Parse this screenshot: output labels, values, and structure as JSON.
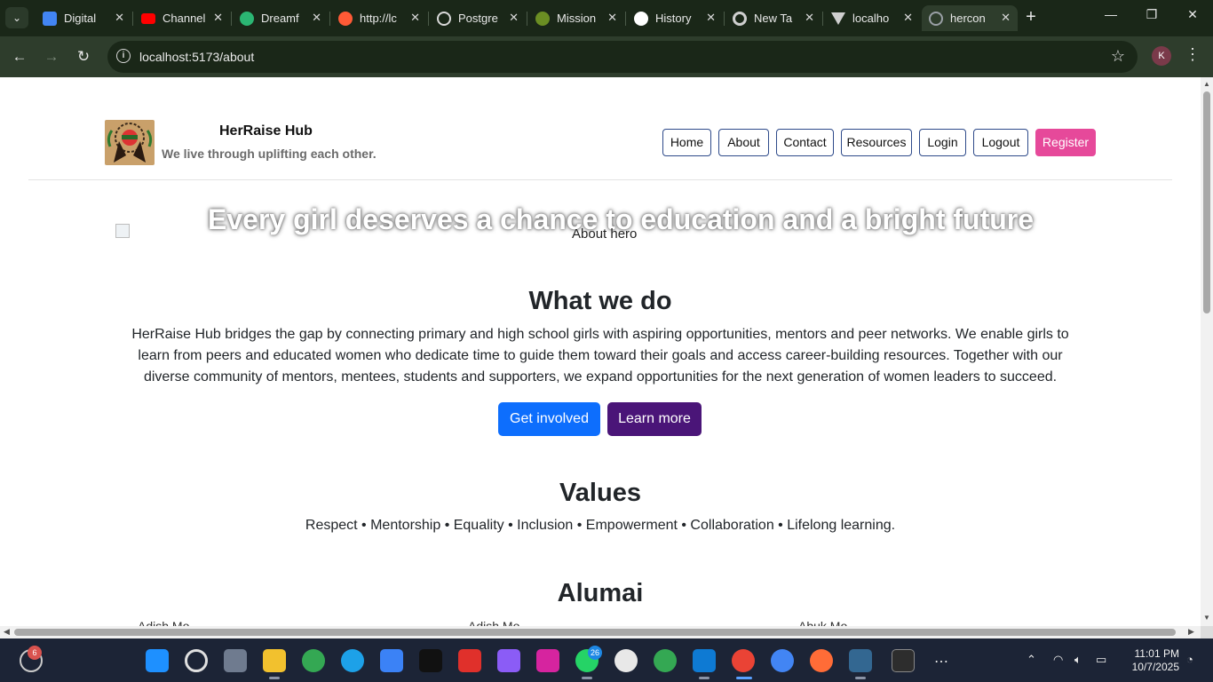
{
  "browser": {
    "tabs": [
      {
        "label": "Digital",
        "color": "#4285f4"
      },
      {
        "label": "Channel",
        "color": "#ff0000"
      },
      {
        "label": "Dreamf",
        "color": "#2bb673"
      },
      {
        "label": "http://lc",
        "color": "#ff5a36"
      },
      {
        "label": "Postgre",
        "color": "#d9d9d9"
      },
      {
        "label": "Mission",
        "color": "#6b8e23"
      },
      {
        "label": "History",
        "color": "#ffffff"
      },
      {
        "label": "New Ta",
        "color": "#cfcfcf"
      },
      {
        "label": "localho",
        "color": "#cfcfcf"
      },
      {
        "label": "hercon",
        "color": "#9aa0a6"
      }
    ],
    "url": "localhost:5173/about",
    "profile_initial": "K"
  },
  "site": {
    "brand_title": "HerRaise Hub",
    "brand_tagline": "We live through uplifting each other.",
    "nav": [
      "Home",
      "About",
      "Contact",
      "Resources",
      "Login",
      "Logout",
      "Register"
    ],
    "hero_text": "Every girl deserves a chance to education and a bright future",
    "hero_alt": "About hero",
    "what_title": "What we do",
    "what_text": "HerRaise Hub bridges the gap by connecting primary and high school girls with aspiring opportunities, mentors and peer networks. We enable girls to learn from peers and educated women who dedicate time to guide them toward their goals and access career-building resources. Together with our diverse community of mentors, mentees, students and supporters, we expand opportunities for the next generation of women leaders to succeed.",
    "btn_get_involved": "Get involved",
    "btn_learn_more": "Learn more",
    "values_title": "Values",
    "values_text": "Respect • Mentorship • Equality • Inclusion • Empowerment • Collaboration • Lifelong learning.",
    "alumni_title": "Alumai",
    "alumni_cut": [
      "Adish Mo",
      "Adish Mo",
      "Abuk Mo"
    ]
  },
  "taskbar": {
    "notification_count": "6",
    "whatsapp_badge": "26",
    "time": "11:01 PM",
    "date": "10/7/2025"
  },
  "colors": {
    "register": "#e6499a",
    "primary_button": "#0d6efd",
    "secondary_button": "#4a1578"
  }
}
